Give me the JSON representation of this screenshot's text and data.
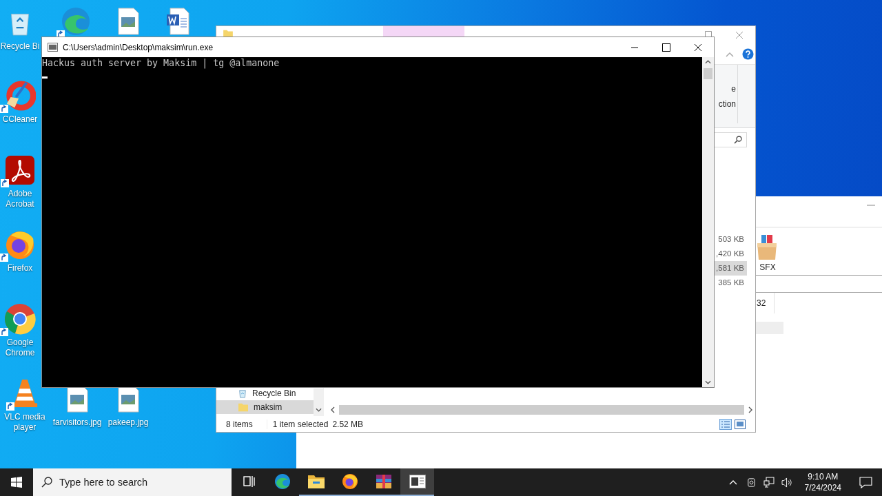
{
  "desktop_icons": [
    {
      "kind": "recycle",
      "label": "Recycle Bi",
      "shortcut": false
    },
    {
      "kind": "edge",
      "shortcut": true
    },
    {
      "kind": "image",
      "shortcut": false
    },
    {
      "kind": "word",
      "shortcut": false
    },
    {
      "kind": "ccleaner",
      "label": "CCleaner",
      "shortcut": true
    },
    {
      "kind": "acrobat",
      "label": "Adobe Acrobat",
      "shortcut": true
    },
    {
      "kind": "firefox",
      "label": "Firefox",
      "shortcut": true
    },
    {
      "kind": "chrome",
      "label": "Google Chrome",
      "shortcut": true
    },
    {
      "kind": "vlc",
      "label": "VLC media player",
      "shortcut": true
    },
    {
      "kind": "image",
      "label": "farvisitors.jpg",
      "shortcut": false
    },
    {
      "kind": "image",
      "label": "pakeep.jpg",
      "shortcut": false
    }
  ],
  "back_window": {
    "file_label": "SFX",
    "column_value": "32"
  },
  "explorer": {
    "ribbon_fragments": [
      "e",
      "ction"
    ],
    "file_sizes": [
      {
        "size": "503 KB",
        "selected": false
      },
      {
        "size": ",420 KB",
        "selected": false
      },
      {
        "size": ",581 KB",
        "selected": true
      },
      {
        "size": "385 KB",
        "selected": false
      }
    ],
    "nav_items": [
      {
        "kind": "recycle",
        "label": "Recycle Bin",
        "selected": false
      },
      {
        "kind": "folder",
        "label": "maksim",
        "selected": true
      }
    ],
    "status": {
      "item_count": "8 items",
      "selection": "1 item selected",
      "size": "2.52 MB"
    }
  },
  "console": {
    "title": "C:\\Users\\admin\\Desktop\\maksim\\run.exe",
    "lines": [
      "Hackus auth server by Maksim | tg @almanone"
    ],
    "cursor": true
  },
  "taskbar": {
    "search_placeholder": "Type here to search",
    "apps": [
      {
        "kind": "taskview",
        "running": false,
        "active": false
      },
      {
        "kind": "edge",
        "running": false,
        "active": false
      },
      {
        "kind": "explorer",
        "running": true,
        "active": false
      },
      {
        "kind": "firefox",
        "running": true,
        "active": false
      },
      {
        "kind": "winrar",
        "running": true,
        "active": false
      },
      {
        "kind": "console",
        "running": true,
        "active": true
      }
    ],
    "time": "9:10 AM",
    "date": "7/24/2024"
  }
}
